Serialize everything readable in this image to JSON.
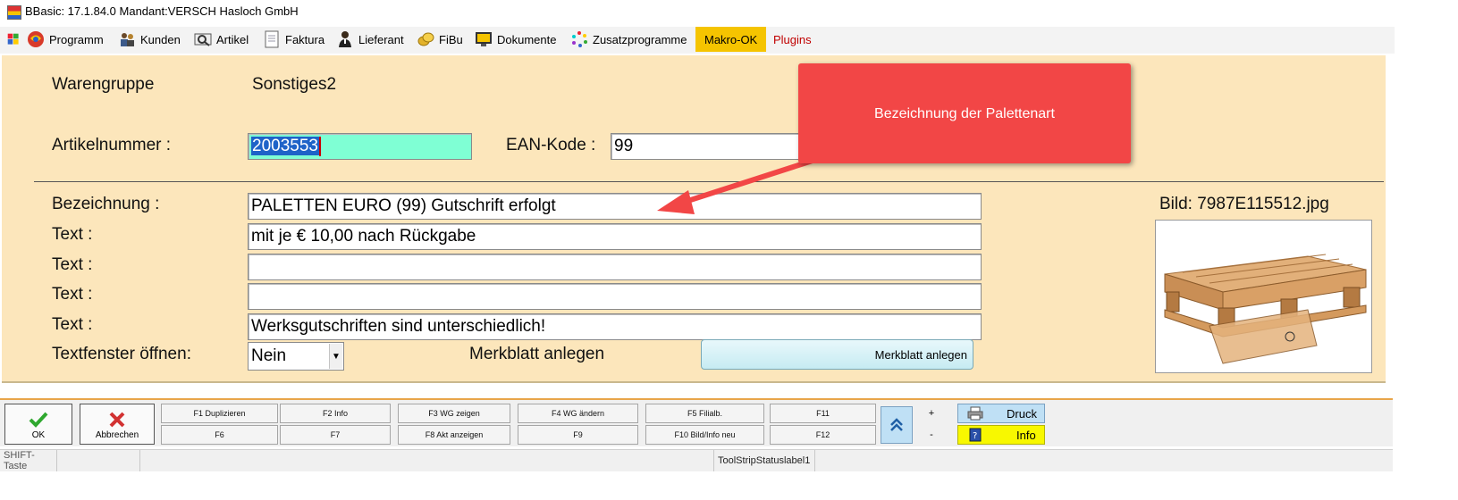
{
  "window": {
    "title": "BBasic: 17.1.84.0 Mandant:VERSCH Hasloch GmbH"
  },
  "menu": {
    "items": [
      {
        "label": "Programm",
        "icon": "globe-icon"
      },
      {
        "label": "Kunden",
        "icon": "people-icon"
      },
      {
        "label": "Artikel",
        "icon": "magnifier-icon"
      },
      {
        "label": "Faktura",
        "icon": "document-icon"
      },
      {
        "label": "Lieferant",
        "icon": "person-icon"
      },
      {
        "label": "FiBu",
        "icon": "coins-icon"
      },
      {
        "label": "Dokumente",
        "icon": "monitor-icon"
      },
      {
        "label": "Zusatzprogramme",
        "icon": "colorful-dots-icon"
      }
    ],
    "makro": "Makro-OK",
    "plugins": "Plugins",
    "colors": {
      "makro_bg": "#f5c400",
      "plugins_text": "#c00000"
    }
  },
  "form": {
    "warengruppe_label": "Warengruppe",
    "warengruppe_value": "Sonstiges2",
    "artikelnummer_label": "Artikelnummer :",
    "artikelnummer_value": "2003553",
    "ean_label": "EAN-Kode :",
    "ean_value": "99",
    "bezeichnung_label": "Bezeichnung :",
    "bezeichnung_value": "PALETTEN EURO (99) Gutschrift erfolgt",
    "text_label": "Text :",
    "text1_value": "mit je € 10,00 nach Rückgabe",
    "text2_value": "",
    "text3_value": "",
    "text4_value": "Werksgutschriften sind unterschiedlich!",
    "textfenster_label": "Textfenster öffnen:",
    "textfenster_value": "Nein",
    "merkblatt_label": "Merkblatt anlegen",
    "merkblatt_button": "Merkblatt anlegen",
    "bild_label": "Bild: 7987E115512.jpg",
    "colors": {
      "panel_bg": "#fce6bb",
      "artnr_bg": "#7fffd4"
    }
  },
  "callout": {
    "text": "Bezeichnung der Palettenart",
    "color": "#f24646"
  },
  "buttons": {
    "ok": "OK",
    "abbrechen": "Abbrechen",
    "f1": "F1 Duplizieren",
    "f2": "F2 Info",
    "f3": "F3 WG zeigen",
    "f4": "F4 WG ändern",
    "f5": "F5 Filialb.",
    "f11": "F11",
    "f6": "F6",
    "f7": "F7",
    "f8": "F8 Akt anzeigen",
    "f9": "F9",
    "f10": "F10 Bild/Info neu",
    "f12": "F12",
    "plus": "+",
    "minus": "-",
    "druck": "Druck",
    "info": "Info"
  },
  "status": {
    "shift": "SHIFT-Taste",
    "label1": "ToolStripStatuslabel1"
  }
}
